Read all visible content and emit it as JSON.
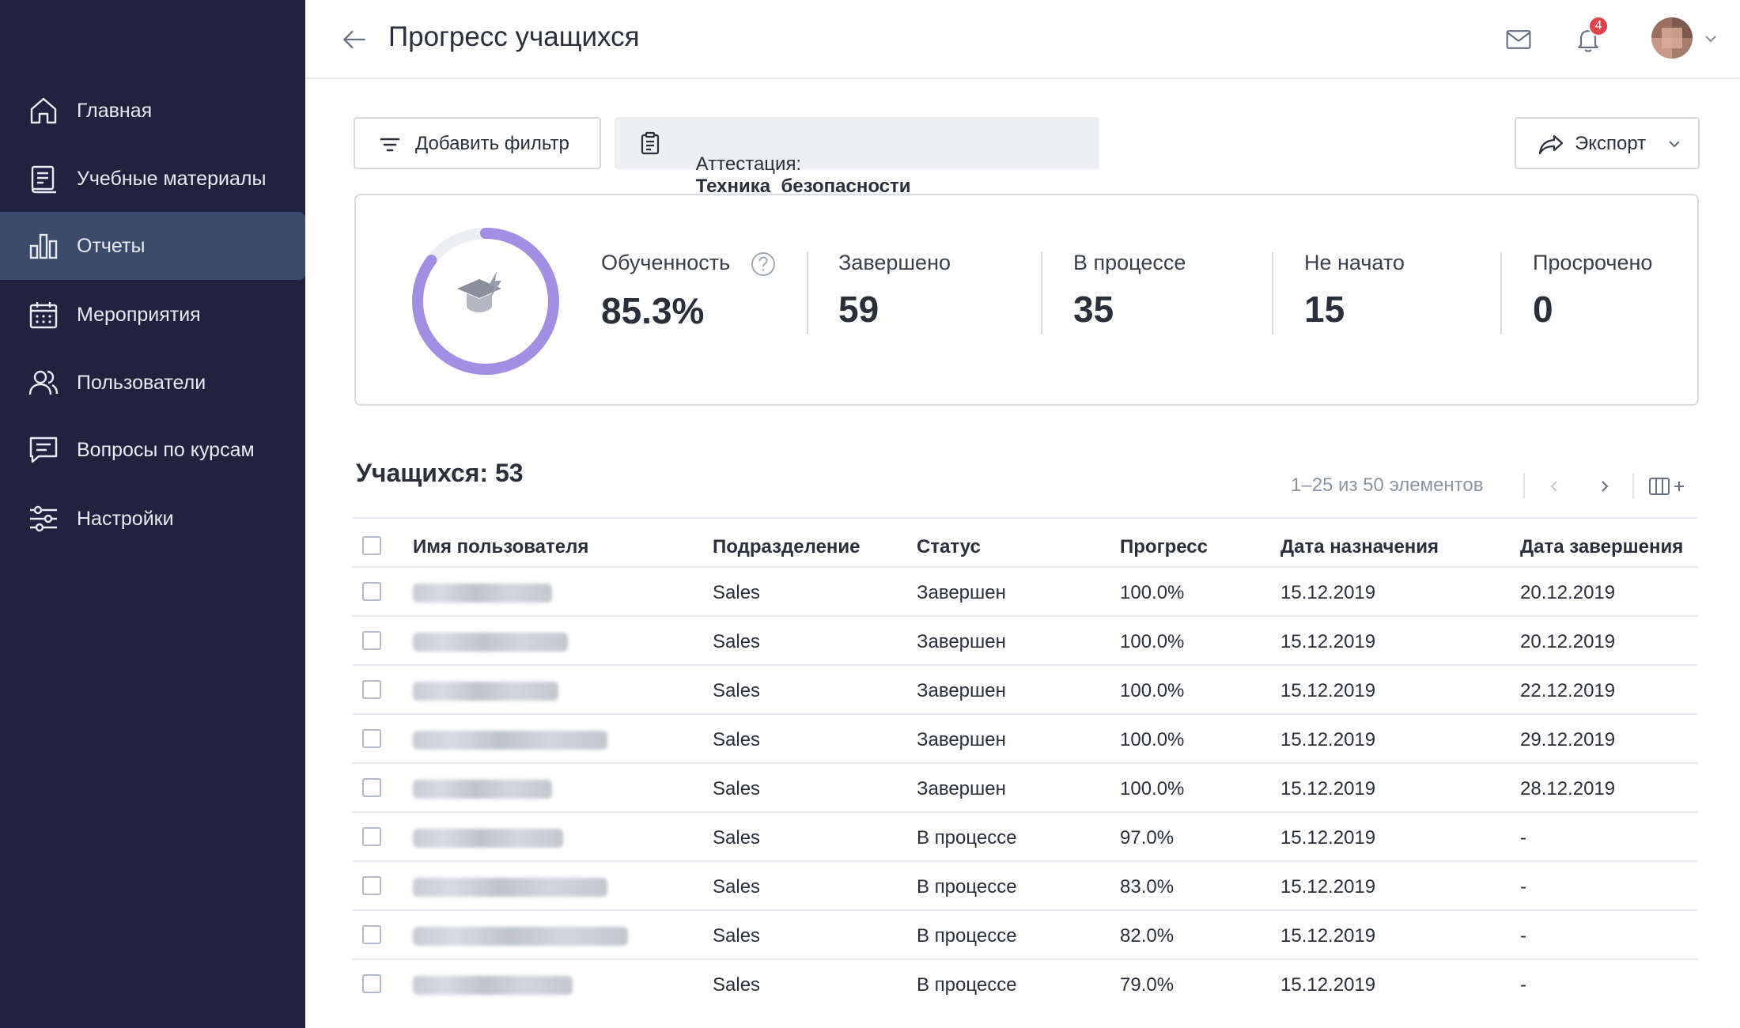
{
  "sidebar": {
    "items": [
      {
        "label": "Главная",
        "icon": "home-icon"
      },
      {
        "label": "Учебные материалы",
        "icon": "book-icon"
      },
      {
        "label": "Отчеты",
        "icon": "bar-chart-icon",
        "active": true
      },
      {
        "label": "Мероприятия",
        "icon": "calendar-icon"
      },
      {
        "label": "Пользователи",
        "icon": "users-icon"
      },
      {
        "label": "Вопросы по курсам",
        "icon": "chat-icon"
      },
      {
        "label": "Настройки",
        "icon": "sliders-icon"
      }
    ]
  },
  "header": {
    "title": "Прогресс учащихся",
    "notifications_count": "4"
  },
  "toolbar": {
    "add_filter_label": "Добавить фильтр",
    "filter_chip_key": "Аттестация:",
    "filter_chip_value": "Техника  безопасности",
    "export_label": "Экспорт"
  },
  "stats": {
    "proficiency_label": "Обученность",
    "proficiency_value": "85.3%",
    "proficiency_fraction": 0.853,
    "completed_label": "Завершено",
    "completed_value": "59",
    "in_progress_label": "В процессе",
    "in_progress_value": "35",
    "not_started_label": "Не начато",
    "not_started_value": "15",
    "overdue_label": "Просрочено",
    "overdue_value": "0"
  },
  "table": {
    "title": "Учащихся: 53",
    "pagination": "1–25 из 50 элементов",
    "columns": [
      "Имя пользователя",
      "Подразделение",
      "Статус",
      "Прогресс",
      "Дата назначения",
      "Дата завершения"
    ],
    "rows": [
      {
        "department": "Sales",
        "status": "Завершен",
        "progress": "100.0%",
        "assigned": "15.12.2019",
        "completed": "20.12.2019"
      },
      {
        "department": "Sales",
        "status": "Завершен",
        "progress": "100.0%",
        "assigned": "15.12.2019",
        "completed": "20.12.2019"
      },
      {
        "department": "Sales",
        "status": "Завершен",
        "progress": "100.0%",
        "assigned": "15.12.2019",
        "completed": "22.12.2019"
      },
      {
        "department": "Sales",
        "status": "Завершен",
        "progress": "100.0%",
        "assigned": "15.12.2019",
        "completed": "29.12.2019"
      },
      {
        "department": "Sales",
        "status": "Завершен",
        "progress": "100.0%",
        "assigned": "15.12.2019",
        "completed": "28.12.2019"
      },
      {
        "department": "Sales",
        "status": "В процессе",
        "progress": "97.0%",
        "assigned": "15.12.2019",
        "completed": "-"
      },
      {
        "department": "Sales",
        "status": "В процессе",
        "progress": "83.0%",
        "assigned": "15.12.2019",
        "completed": "-"
      },
      {
        "department": "Sales",
        "status": "В процессе",
        "progress": "82.0%",
        "assigned": "15.12.2019",
        "completed": "-"
      },
      {
        "department": "Sales",
        "status": "В процессе",
        "progress": "79.0%",
        "assigned": "15.12.2019",
        "completed": "-"
      }
    ]
  },
  "colors": {
    "sidebar_bg": "#1f2340",
    "sidebar_active": "#3b4b6b",
    "accent_ring": "#a18fe3",
    "badge": "#e2434b"
  }
}
